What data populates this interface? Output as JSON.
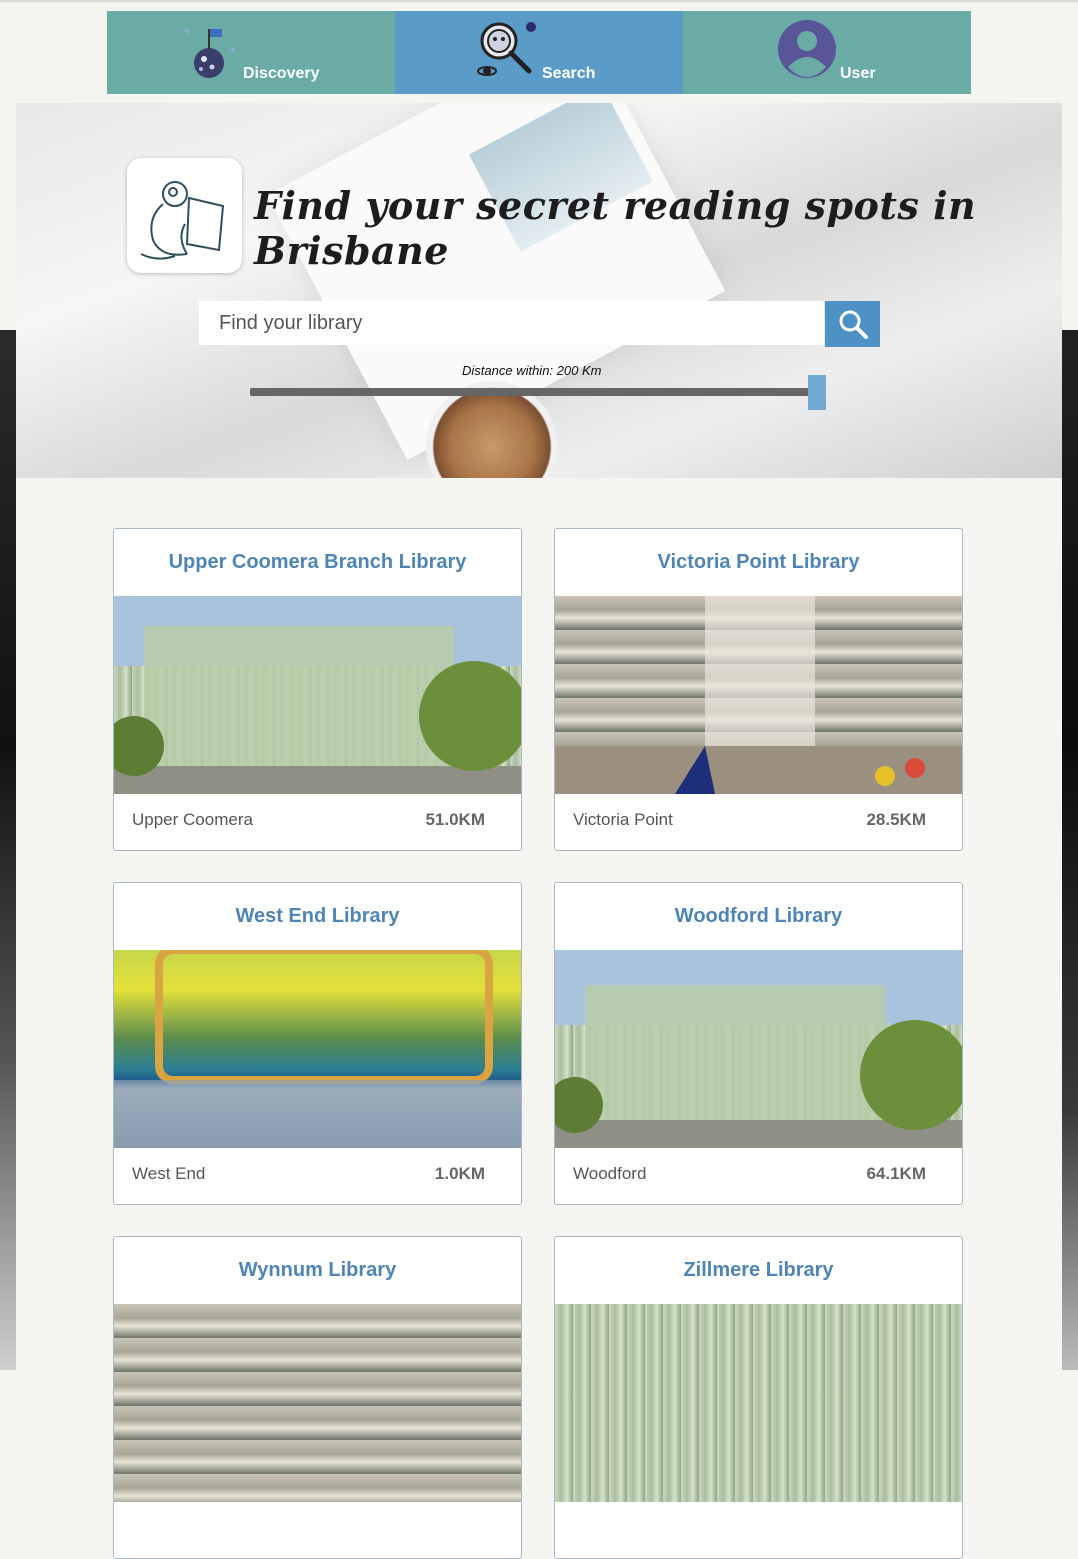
{
  "nav": {
    "items": [
      {
        "label": "Discovery",
        "icon": "disco-ball-icon"
      },
      {
        "label": "Search",
        "icon": "search-astronaut-icon",
        "active": true
      },
      {
        "label": "User",
        "icon": "user-avatar-icon"
      }
    ]
  },
  "hero": {
    "title": "Find your secret reading spots in Brisbane",
    "search_placeholder": "Find your library",
    "distance_label": "Distance within: 200 Km",
    "distance_value_km": 200
  },
  "libraries": [
    {
      "name": "Upper Coomera Branch Library",
      "suburb": "Upper Coomera",
      "distance": "51.0KM"
    },
    {
      "name": "Victoria Point Library",
      "suburb": "Victoria Point",
      "distance": "28.5KM"
    },
    {
      "name": "West End Library",
      "suburb": "West End",
      "distance": "1.0KM"
    },
    {
      "name": "Woodford Library",
      "suburb": "Woodford",
      "distance": "64.1KM"
    },
    {
      "name": "Wynnum Library"
    },
    {
      "name": "Zillmere Library"
    }
  ],
  "colors": {
    "nav_teal": "#6aaba5",
    "nav_active": "#5a9cc7",
    "title_blue": "#4f85b5",
    "search_button": "#4d91c5"
  }
}
